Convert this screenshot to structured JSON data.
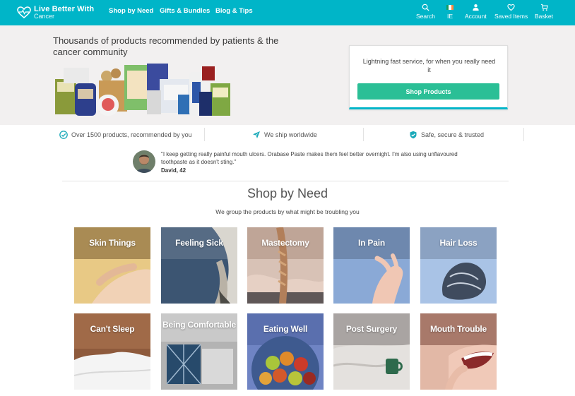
{
  "nav": {
    "logo_line1": "Live Better With",
    "logo_line2": "Cancer",
    "links": [
      "Shop by Need",
      "Gifts & Bundles",
      "Blog & Tips"
    ],
    "right": {
      "search": "Search",
      "region": "IE",
      "account": "Account",
      "saved": "Saved Items",
      "basket": "Basket"
    },
    "colors": {
      "bar": "#00b5c8"
    }
  },
  "hero": {
    "title": "Thousands of products recommended by patients & the cancer community",
    "cta_text": "Lightning fast service, for when you really need it",
    "cta_button": "Shop Products",
    "colors": {
      "background": "#f2f0f0",
      "button": "#2bbf96"
    }
  },
  "usps": [
    {
      "icon": "check-circle-icon",
      "text": "Over 1500 products, recommended by you"
    },
    {
      "icon": "plane-icon",
      "text": "We ship worldwide"
    },
    {
      "icon": "shield-check-icon",
      "text": "Safe, secure & trusted"
    }
  ],
  "testimonial": {
    "quote": "\"I keep getting really painful mouth ulcers. Orabase Paste makes them feel better overnight. I'm also using unflavoured toothpaste as it doesn't sting.\"",
    "author": "David, 42"
  },
  "shop_by_need": {
    "title": "Shop by Need",
    "subtitle": "We group the products by what might be troubling you",
    "tiles": [
      {
        "label": "Skin Things"
      },
      {
        "label": "Feeling Sick"
      },
      {
        "label": "Mastectomy"
      },
      {
        "label": "In Pain"
      },
      {
        "label": "Hair Loss"
      },
      {
        "label": "Can't Sleep"
      },
      {
        "label": "Being Comfortable"
      },
      {
        "label": "Eating Well"
      },
      {
        "label": "Post Surgery"
      },
      {
        "label": "Mouth Trouble"
      }
    ]
  }
}
